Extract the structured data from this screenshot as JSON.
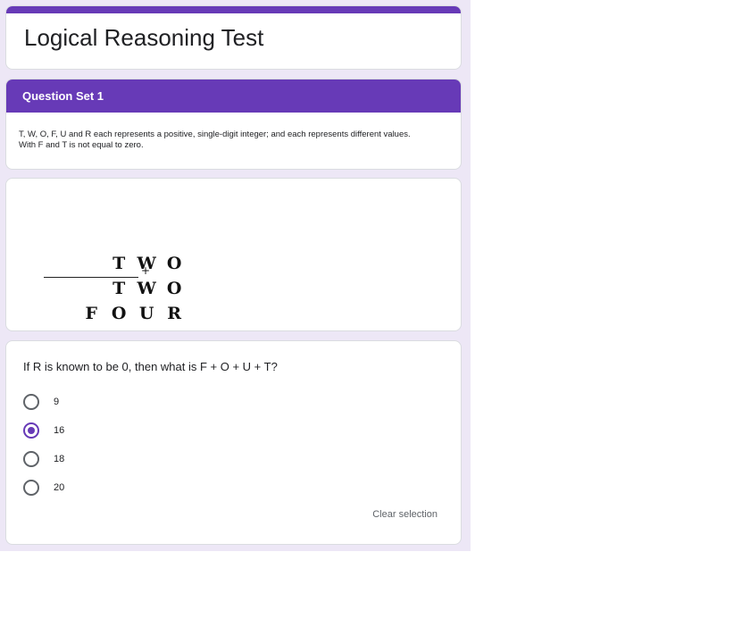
{
  "form": {
    "title": "Logical Reasoning Test",
    "accent_color": "#673ab7",
    "background_color": "#ede7f6"
  },
  "section": {
    "header": "Question Set 1",
    "description_line1": "T, W, O, F, U and R each represents a positive, single-digit integer; and each represents different values.",
    "description_line2": "With F and T is not equal to zero."
  },
  "puzzle": {
    "row1": [
      "T",
      "W",
      "O"
    ],
    "row2": [
      "T",
      "W",
      "O"
    ],
    "operator": "+",
    "row3": [
      "F",
      "O",
      "U",
      "R"
    ]
  },
  "question": {
    "text": "If R is known to be 0, then what is F + O + U + T?",
    "options": [
      {
        "label": "9",
        "selected": false
      },
      {
        "label": "16",
        "selected": true
      },
      {
        "label": "18",
        "selected": false
      },
      {
        "label": "20",
        "selected": false
      }
    ],
    "clear_label": "Clear selection"
  }
}
